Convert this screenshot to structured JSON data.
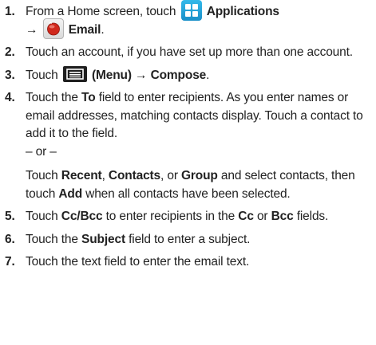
{
  "steps": [
    {
      "num": "1.",
      "parts": {
        "a": "From a Home screen, touch ",
        "b_apps": "Applications",
        "c_arrow": "→",
        "d_email": "Email",
        "e": "."
      }
    },
    {
      "num": "2.",
      "text": "Touch an account, if you have set up more than one account."
    },
    {
      "num": "3.",
      "parts": {
        "a": "Touch ",
        "b_menu": "(Menu)",
        "c_arrow": "→",
        "d_compose": "Compose",
        "e": "."
      }
    },
    {
      "num": "4.",
      "parts": {
        "a": "Touch the ",
        "b_to": "To",
        "c": " field to enter recipients. As you enter names or email addresses, matching contacts display. Touch a contact to add it to the field.",
        "or": "– or –",
        "d": "Touch ",
        "e_recent": "Recent",
        "f": ", ",
        "g_contacts": "Contacts",
        "h": ", or ",
        "i_group": "Group",
        "j": " and select contacts, then touch ",
        "k_add": "Add",
        "l": " when all contacts have been selected."
      }
    },
    {
      "num": "5.",
      "parts": {
        "a": "Touch ",
        "b_ccbcc": "Cc/Bcc",
        "c": " to enter recipients in the ",
        "d_cc": "Cc",
        "e": " or ",
        "f_bcc": "Bcc",
        "g": " fields."
      }
    },
    {
      "num": "6.",
      "parts": {
        "a": "Touch the ",
        "b_subject": "Subject",
        "c": " field to enter a subject."
      }
    },
    {
      "num": "7.",
      "text": "Touch the text field to enter the email text."
    }
  ],
  "icons": {
    "applications": "applications-grid-icon",
    "email": "email-icon",
    "menu": "menu-icon"
  },
  "colors": {
    "text": "#222222",
    "apps_icon": "#1a8fc8",
    "email_icon_red": "#d0281c",
    "menu_icon": "#1f1f1f"
  }
}
